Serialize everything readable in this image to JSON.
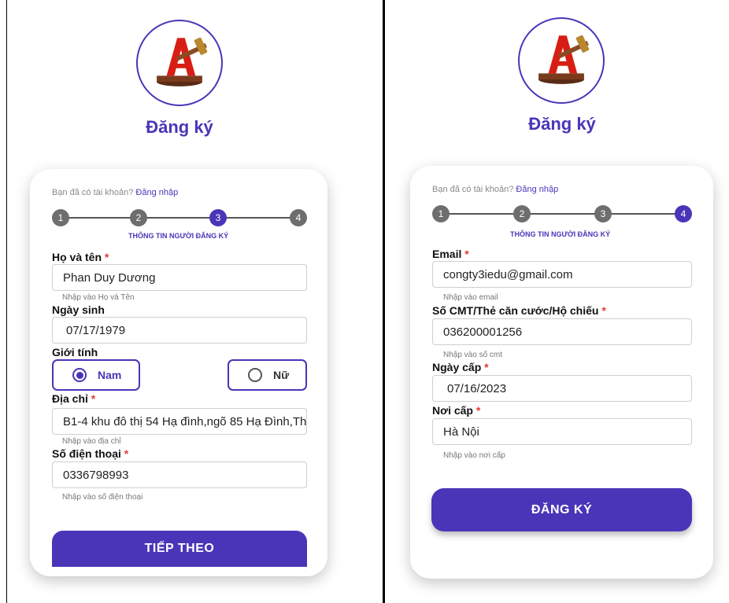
{
  "colors": {
    "accent": "#4A35B8",
    "required": "#e53935",
    "step_inactive": "#6e6e6e"
  },
  "icons": {
    "logo": "gavel-letter-a-logo",
    "radio_on": "radio-checked-icon",
    "radio_off": "radio-unchecked-icon"
  },
  "left": {
    "title": "Đăng ký",
    "login_prompt": {
      "text": "Bạn đã có tài khoản?",
      "link": "Đăng nhập"
    },
    "steps": [
      "1",
      "2",
      "3",
      "4"
    ],
    "active_step": 3,
    "step_caption": "THÔNG TIN NGƯỜI ĐĂNG KÝ",
    "full_name": {
      "label": "Họ và tên",
      "required": "*",
      "value": "Phan Duy Dương",
      "hint": "Nhập vào Họ và Tên"
    },
    "dob": {
      "label": "Ngày sinh",
      "value": "07/17/1979"
    },
    "gender": {
      "label": "Giới tính",
      "male": "Nam",
      "female": "Nữ",
      "selected": "Nam"
    },
    "address": {
      "label": "Địa chỉ",
      "required": "*",
      "value": "B1-4 khu đô thị 54 Hạ đình,ngõ 85 Hạ Đình,Th",
      "hint": "Nhập vào địa chỉ"
    },
    "phone": {
      "label": "Số điện thoại",
      "required": "*",
      "value": "0336798993",
      "hint": "Nhập vào số điện thoại"
    },
    "next_button": "TIẾP THEO"
  },
  "right": {
    "title": "Đăng ký",
    "login_prompt": {
      "text": "Bạn đã có tài khoản?",
      "link": "Đăng nhập"
    },
    "steps": [
      "1",
      "2",
      "3",
      "4"
    ],
    "active_step": 4,
    "step_caption": "THÔNG TIN NGƯỜI ĐĂNG KÝ",
    "email": {
      "label": "Email",
      "required": "*",
      "value": "congty3iedu@gmail.com",
      "hint": "Nhập vào email"
    },
    "id_number": {
      "label": "Số CMT/Thẻ căn cước/Hộ chiếu",
      "required": "*",
      "value": "036200001256",
      "hint": "Nhập vào số cmt"
    },
    "issue_date": {
      "label": "Ngày cấp",
      "required": "*",
      "value": "07/16/2023"
    },
    "issue_place": {
      "label": "Nơi cấp",
      "required": "*",
      "value": "Hà Nội",
      "hint": "Nhập vào nơi cấp"
    },
    "register_button": "ĐĂNG KÝ"
  }
}
